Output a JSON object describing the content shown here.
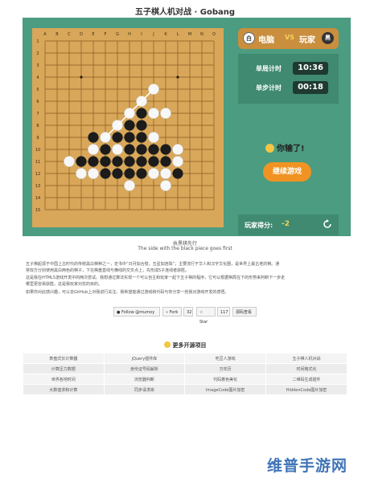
{
  "title": "五子棋人机对战 · Gobang",
  "board": {
    "col_labels": [
      "A",
      "B",
      "C",
      "D",
      "E",
      "F",
      "G",
      "H",
      "I",
      "J",
      "K",
      "L",
      "M",
      "N",
      "O"
    ],
    "row_labels": [
      "1",
      "2",
      "3",
      "4",
      "5",
      "6",
      "7",
      "8",
      "9",
      "10",
      "11",
      "12",
      "13",
      "14",
      "15"
    ],
    "colors": {
      "board": "#d8a75a",
      "line": "#8a5a22",
      "black": "#1c1c1c",
      "white": "#f7f7f7",
      "win_line": "#ffffff"
    },
    "black_stones": [
      [
        8,
        6
      ],
      [
        7,
        7
      ],
      [
        8,
        7
      ],
      [
        4,
        8
      ],
      [
        6,
        8
      ],
      [
        7,
        8
      ],
      [
        8,
        8
      ],
      [
        5,
        9
      ],
      [
        7,
        9
      ],
      [
        8,
        9
      ],
      [
        9,
        9
      ],
      [
        10,
        9
      ],
      [
        3,
        10
      ],
      [
        4,
        10
      ],
      [
        5,
        10
      ],
      [
        6,
        10
      ],
      [
        7,
        10
      ],
      [
        8,
        10
      ],
      [
        9,
        10
      ],
      [
        10,
        10
      ],
      [
        5,
        11
      ],
      [
        6,
        11
      ],
      [
        7,
        11
      ],
      [
        8,
        11
      ],
      [
        11,
        11
      ]
    ],
    "white_stones": [
      [
        9,
        4
      ],
      [
        8,
        5
      ],
      [
        7,
        6
      ],
      [
        9,
        6
      ],
      [
        10,
        6
      ],
      [
        6,
        7
      ],
      [
        5,
        8
      ],
      [
        9,
        8
      ],
      [
        4,
        9
      ],
      [
        6,
        9
      ],
      [
        11,
        9
      ],
      [
        2,
        10
      ],
      [
        11,
        10
      ],
      [
        3,
        11
      ],
      [
        4,
        11
      ],
      [
        9,
        11
      ],
      [
        10,
        11
      ],
      [
        7,
        12
      ],
      [
        10,
        12
      ]
    ],
    "win_line": [
      [
        9,
        4
      ],
      [
        5,
        8
      ]
    ],
    "star_points": [
      [
        3,
        3
      ],
      [
        11,
        3
      ],
      [
        7,
        7
      ],
      [
        3,
        11
      ],
      [
        11,
        11
      ]
    ]
  },
  "sidebar": {
    "white_badge": "白",
    "computer_label": "电脑",
    "vs_label": "VS",
    "player_label": "玩家",
    "black_badge": "黑",
    "game_time_label": "单局计时",
    "game_time_value": "10:36",
    "step_time_label": "单步计时",
    "step_time_value": "00:18",
    "result_text": "你输了!",
    "continue_label": "继续游戏",
    "score_label": "玩家得分:",
    "score_value": "-2"
  },
  "caption": {
    "cn": "执黑棋先行",
    "en": "The side with the black piece goes first"
  },
  "description": [
    "五子棋起源于中国上古时代的传统黑白棋种之一，史书中“日月如合璧，五星如连珠”，主要流行于华人和汉字文化圈，是世界上最古老的棋。通",
    "常双方分别使用黑白两色的棋子，下在棋盘直线与横线的交叉点上，先形成5子连线者获胜。",
    "这是我在HTML5游戏开发中的两次尝试。我想通过算法实现一个可以自主和玩家一起下五子棋的程序，它可以根据棋局在下的形势来判断下一步走",
    "哪里更容易获胜。这是我玩家对抗的目的。",
    "如果你对此感兴趣，可以去GitHub上对我进行关注。我希望能通过游戏和代码与你分享一些我对游戏开发的感悟。"
  ],
  "github": {
    "follow_label": "Follow @mumoy",
    "fork_label": "Fork",
    "fork_count": "32",
    "star_label": "Star",
    "star_count": "117",
    "source_label": "源码查看"
  },
  "more_projects": {
    "title": "更多开源项目",
    "rows": [
      [
        "表盘式长计算器",
        "jQuery插件库",
        "吃豆人游戏",
        "五子棋人机对战"
      ],
      [
        "计算压力数据",
        "身份证号码解析",
        "万年历",
        "时间格式化"
      ],
      [
        "世界各地时间",
        "浏览器判断",
        "代码着色美化",
        "二维码生成插件"
      ],
      [
        "大数值求和计算",
        "同步请求库",
        "ImageCode图片加密",
        "HiddenCode图片加密"
      ]
    ]
  },
  "watermark": "维普手游网"
}
